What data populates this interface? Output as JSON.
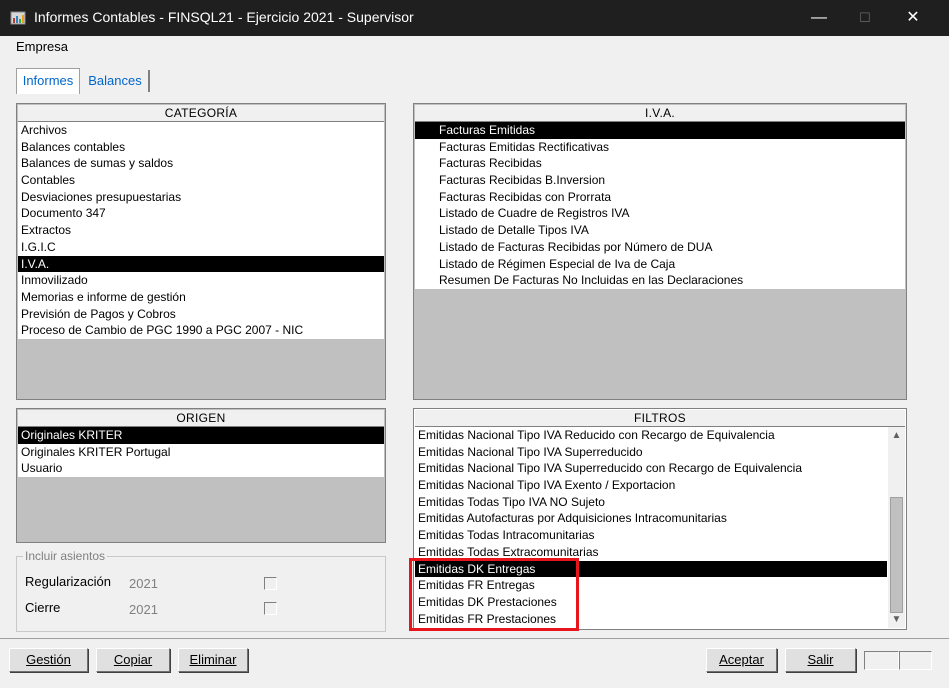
{
  "window": {
    "title": "Informes Contables - FINSQL21 - Ejercicio 2021 - Supervisor",
    "minimize": "—",
    "maximize": "☐",
    "close": "✕"
  },
  "menu": {
    "empresa": "Empresa"
  },
  "tabs": [
    {
      "label": "Informes",
      "active": true
    },
    {
      "label": "Balances",
      "active": false
    }
  ],
  "categoria": {
    "header": "CATEGORÍA",
    "items": [
      "Archivos",
      "Balances contables",
      "Balances de sumas y saldos",
      "Contables",
      "Desviaciones presupuestarias",
      "Documento 347",
      "Extractos",
      "I.G.I.C",
      "I.V.A.",
      "Inmovilizado",
      "Memorias e informe de gestión",
      "Previsión de Pagos y Cobros",
      "Proceso de Cambio de PGC 1990 a PGC 2007 - NIC"
    ],
    "selected_index": 8
  },
  "iva": {
    "header": "I.V.A.",
    "items": [
      "Facturas Emitidas",
      "Facturas Emitidas Rectificativas",
      "Facturas Recibidas",
      "Facturas Recibidas B.Inversion",
      "Facturas Recibidas con Prorrata",
      "Listado de Cuadre de Registros IVA",
      "Listado de Detalle Tipos IVA",
      "Listado de Facturas Recibidas por Número de DUA",
      "Listado de Régimen Especial de Iva de Caja",
      "Resumen De Facturas No Incluidas en las Declaraciones"
    ],
    "selected_index": 0
  },
  "origen": {
    "header": "ORIGEN",
    "items": [
      "Originales KRITER",
      "Originales KRITER Portugal",
      "Usuario"
    ],
    "selected_index": 0
  },
  "filtros": {
    "header": "FILTROS",
    "items": [
      "Emitidas Nacional Tipo IVA Reducido con Recargo de Equivalencia",
      "Emitidas Nacional Tipo IVA Superreducido",
      "Emitidas Nacional Tipo IVA Superreducido con Recargo de Equivalencia",
      "Emitidas Nacional Tipo IVA Exento / Exportacion",
      "Emitidas Todas Tipo IVA NO Sujeto",
      "Emitidas Autofacturas por Adquisiciones Intracomunitarias",
      "Emitidas Todas Intracomunitarias",
      "Emitidas Todas Extracomunitarias",
      "Emitidas DK Entregas",
      "Emitidas FR Entregas",
      "Emitidas DK Prestaciones",
      "Emitidas FR Prestaciones"
    ],
    "selected_index": 8,
    "scroll_up": "▲",
    "scroll_down": "▼"
  },
  "incluir_asientos": {
    "legend": "Incluir asientos",
    "rows": [
      {
        "label": "Regularización",
        "year": "2021"
      },
      {
        "label": "Cierre",
        "year": "2021"
      }
    ]
  },
  "buttons": {
    "gestion": "Gestión",
    "copiar": "Copiar",
    "eliminar": "Eliminar",
    "aceptar": "Aceptar",
    "salir": "Salir"
  },
  "colors": {
    "titlebar": "#1f1f1f",
    "selection": "#000000",
    "highlight": "#e8161c",
    "tab_text": "#0066cc"
  }
}
